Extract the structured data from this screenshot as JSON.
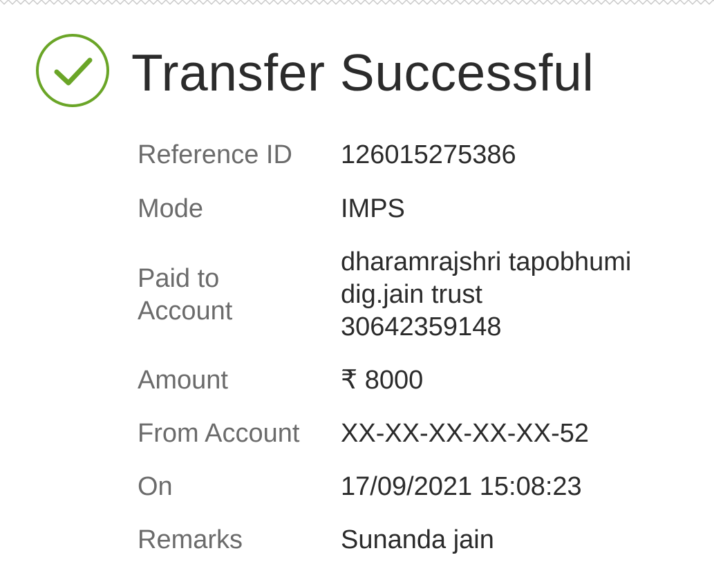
{
  "header": {
    "title": "Transfer Successful",
    "status_color": "#6aa527",
    "icon": "check-circle-icon"
  },
  "details": {
    "reference_id": {
      "label": "Reference ID",
      "value": "126015275386"
    },
    "mode": {
      "label": "Mode",
      "value": "IMPS"
    },
    "paid_to": {
      "label_line1": "Paid to",
      "label_line2": "Account",
      "value_line1": "dharamrajshri tapobhumi",
      "value_line2": "dig.jain trust",
      "value_line3": "30642359148"
    },
    "amount": {
      "label": "Amount",
      "value": "₹ 8000"
    },
    "from_account": {
      "label": "From Account",
      "value": "XX-XX-XX-XX-XX-52"
    },
    "on": {
      "label": "On",
      "value": "17/09/2021 15:08:23"
    },
    "remarks": {
      "label": "Remarks",
      "value": "Sunanda jain"
    }
  }
}
